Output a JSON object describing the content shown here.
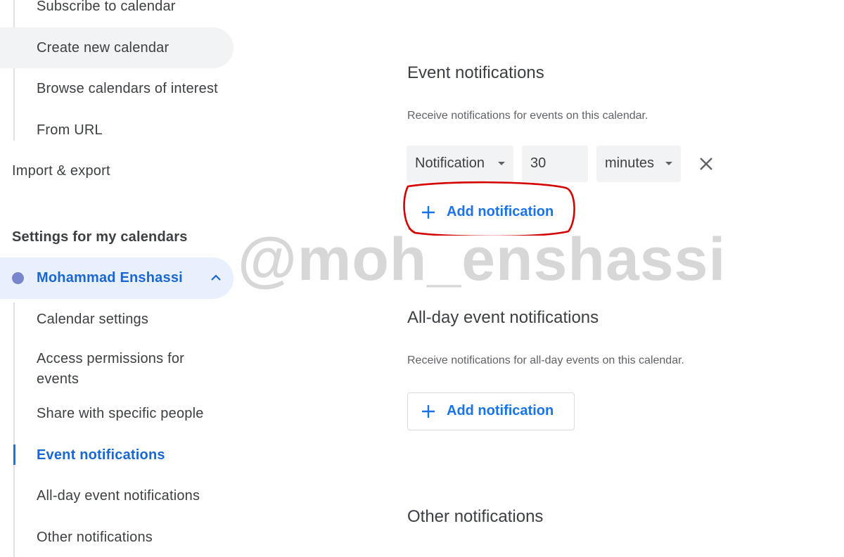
{
  "sidebar": {
    "add_calendar_items": [
      "Subscribe to calendar",
      "Create new calendar",
      "Browse calendars of interest",
      "From URL"
    ],
    "import_export": "Import & export",
    "section_title": "Settings for my calendars",
    "calendar": {
      "name": "Mohammad Enshassi",
      "color": "#7986cb"
    },
    "calendar_settings": {
      "item1": "Calendar settings",
      "item2": "Access permissions for events",
      "item3": "Share with specific people",
      "item4": "Event notifications",
      "item5": "All-day event notifications",
      "item6": "Other notifications"
    },
    "active_item": "Event notifications"
  },
  "main": {
    "event_notifications": {
      "title": "Event notifications",
      "description": "Receive notifications for events on this calendar.",
      "notification": {
        "type": "Notification",
        "amount": "30",
        "unit": "minutes"
      },
      "add_label": "Add notification"
    },
    "allday_notifications": {
      "title": "All-day event notifications",
      "description": "Receive notifications for all-day events on this calendar.",
      "add_label": "Add notification"
    },
    "other_notifications": {
      "title": "Other notifications"
    }
  },
  "watermark": "@moh_enshassi",
  "colors": {
    "accent": "#1a73e8",
    "annotation": "#d50000"
  }
}
